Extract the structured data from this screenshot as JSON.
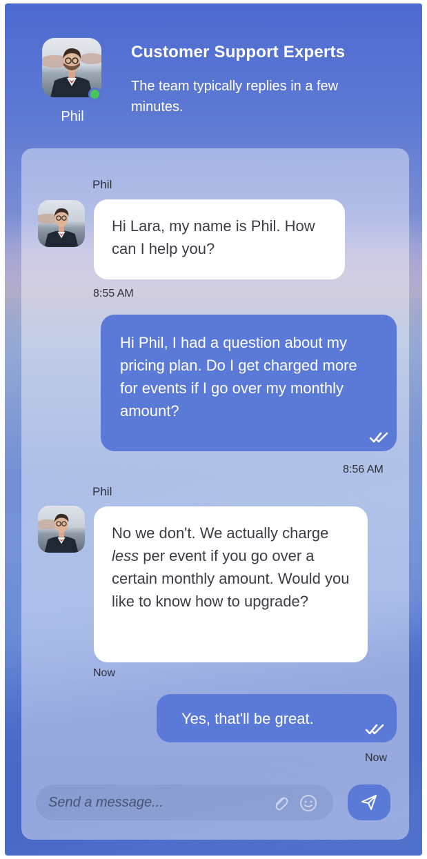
{
  "header": {
    "agent_name": "Phil",
    "title": "Customer Support Experts",
    "subtitle": "The team typically replies in a few minutes."
  },
  "messages": [
    {
      "direction": "incoming",
      "sender": "Phil",
      "text": "Hi Lara, my name is Phil. How can I help you?",
      "time": "8:55 AM"
    },
    {
      "direction": "outgoing",
      "text": "Hi Phil, I had a question about my pricing plan. Do I get charged more for events if I go over my monthly amount?",
      "time": "8:56 AM",
      "status": "read"
    },
    {
      "direction": "incoming",
      "sender": "Phil",
      "text_before": "No we don't. We actually charge ",
      "text_emphasis": "less",
      "text_after": " per event if you go over a certain monthly amount. Would you like to know how to upgrade?",
      "time": "Now"
    },
    {
      "direction": "outgoing",
      "text": "Yes, that'll be great.",
      "time": "Now",
      "status": "read"
    }
  ],
  "composer": {
    "placeholder": "Send a message...",
    "value": ""
  },
  "icons": {
    "attach": "paperclip-icon",
    "emoji": "smiley-icon",
    "send": "paper-plane-icon",
    "read": "double-check-icon"
  },
  "colors": {
    "accent": "#5b7ad8",
    "online": "#45c75a",
    "bubble_incoming": "#ffffff"
  }
}
